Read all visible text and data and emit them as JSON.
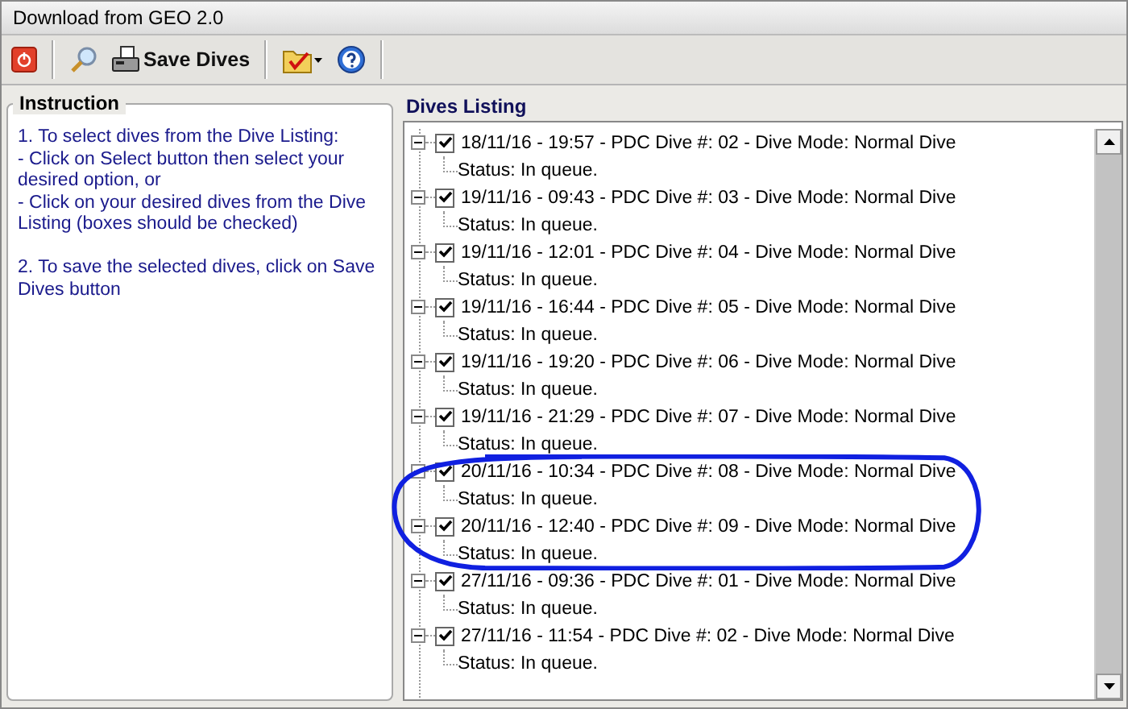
{
  "window": {
    "title": "Download from GEO 2.0"
  },
  "toolbar": {
    "save_label": "Save Dives"
  },
  "instruction": {
    "title": "Instruction",
    "paragraphs": [
      [
        "1. To select dives from the Dive Listing:",
        "- Click on Select button then select your",
        "desired option, or",
        "- Click on your desired dives from the Dive",
        "Listing (boxes should be checked)"
      ],
      [
        "2. To save the selected dives, click on Save",
        "Dives button"
      ]
    ]
  },
  "dives": {
    "title": "Dives Listing",
    "items": [
      {
        "label": "18/11/16 - 19:57 - PDC Dive #: 02 - Dive Mode: Normal Dive",
        "checked": true,
        "expanded": true,
        "circled": false,
        "status": "Status: In queue."
      },
      {
        "label": "19/11/16 - 09:43 - PDC Dive #: 03 - Dive Mode: Normal Dive",
        "checked": true,
        "expanded": true,
        "circled": false,
        "status": "Status: In queue."
      },
      {
        "label": "19/11/16 - 12:01 - PDC Dive #: 04 - Dive Mode: Normal Dive",
        "checked": true,
        "expanded": true,
        "circled": false,
        "status": "Status: In queue."
      },
      {
        "label": "19/11/16 - 16:44 - PDC Dive #: 05 - Dive Mode: Normal Dive",
        "checked": true,
        "expanded": true,
        "circled": false,
        "status": "Status: In queue."
      },
      {
        "label": "19/11/16 - 19:20 - PDC Dive #: 06 - Dive Mode: Normal Dive",
        "checked": true,
        "expanded": true,
        "circled": false,
        "status": "Status: In queue."
      },
      {
        "label": "19/11/16 - 21:29 - PDC Dive #: 07 - Dive Mode: Normal Dive",
        "checked": true,
        "expanded": true,
        "circled": false,
        "status": "Status: In queue."
      },
      {
        "label": "20/11/16 - 10:34 - PDC Dive #: 08 - Dive Mode: Normal Dive",
        "checked": true,
        "expanded": true,
        "circled": true,
        "status": "Status: In queue."
      },
      {
        "label": "20/11/16 - 12:40 - PDC Dive #: 09 - Dive Mode: Normal Dive",
        "checked": true,
        "expanded": true,
        "circled": true,
        "status": "Status: In queue."
      },
      {
        "label": "27/11/16 - 09:36 - PDC Dive #: 01 - Dive Mode: Normal Dive",
        "checked": true,
        "expanded": true,
        "circled": false,
        "status": "Status: In queue."
      },
      {
        "label": "27/11/16 - 11:54 - PDC Dive #: 02 - Dive Mode: Normal Dive",
        "checked": true,
        "expanded": true,
        "circled": false,
        "status": "Status: In queue."
      }
    ]
  }
}
